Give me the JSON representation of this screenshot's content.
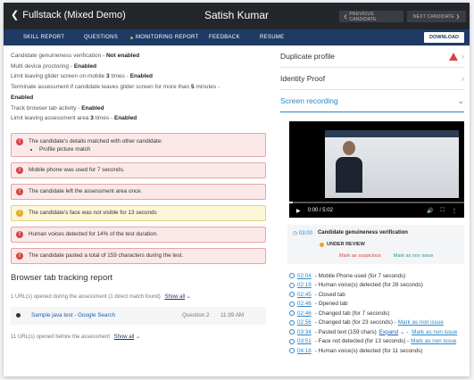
{
  "header": {
    "back_label": "Fullstack (Mixed Demo)",
    "candidate_name": "Satish Kumar",
    "prev_label": "PREVIOUS CANDIDATE",
    "next_label": "NEXT CANDIDATE"
  },
  "tabs": [
    {
      "label": "SKILL REPORT"
    },
    {
      "label": "QUESTIONS"
    },
    {
      "label": "MONITORING REPORT",
      "active": true
    },
    {
      "label": "FEEDBACK"
    },
    {
      "label": "RESUME"
    }
  ],
  "download_label": "DOWNLOAD",
  "settings": [
    {
      "text": "Candidate genuineness verification - ",
      "value": "Not enabled"
    },
    {
      "text": "Multi device proctoring - ",
      "value": "Enabled"
    },
    {
      "text_a": "Limit leaving glider screen on mobile ",
      "num": "3",
      "text_b": " times - ",
      "value": "Enabled"
    },
    {
      "text_a": "Terminate assessment if candidate leaves glider screen for more than ",
      "num": "5",
      "text_b": " minutes -"
    },
    {
      "value": "Enabled"
    },
    {
      "text": "Track browser tab activity - ",
      "value": "Enabled"
    },
    {
      "text_a": "Limit leaving assessment area ",
      "num": "3",
      "text_b": " times - ",
      "value": "Enabled"
    }
  ],
  "alerts": [
    {
      "text": "The candidate's details matched with other candidate:",
      "sub": "Profile picture match",
      "level": "error"
    },
    {
      "text": "Mobile phone was used for 7 seconds.",
      "level": "error"
    },
    {
      "text": "The candidate left the assessment area once.",
      "level": "error"
    },
    {
      "text": "The candidate's face was not visible for 13 seconds",
      "level": "warn"
    },
    {
      "text": "Human voices detected for 14% of the test duration.",
      "level": "error"
    },
    {
      "text": "The candidate pasted a total of 159 characters during the test.",
      "level": "error"
    }
  ],
  "browser_tab": {
    "title": "Browser tab tracking report",
    "during_note": "1 URL(s) opened during the assessment (1 direct match found)",
    "show_all": "Show all",
    "url_row": {
      "link": "Sample java test - Google Search",
      "question": "Question 2",
      "time": "11:39 AM"
    },
    "before_note": "11 URL(s) opened before the assessment"
  },
  "right": {
    "duplicate_label": "Duplicate profile",
    "identity_label": "Identity Proof",
    "recording_label": "Screen recording",
    "video_time": "0:00 / 5:02",
    "genuine": {
      "time": "03:00",
      "title": "Candidate genuineness verification",
      "status": "UNDER REVIEW",
      "mark_suspicious": "Mark as suspicious",
      "mark_non_issue": "Mark as non issue"
    },
    "events": [
      {
        "time": "02:04",
        "text": "- Mobile Phone used (for 7 seconds)"
      },
      {
        "time": "02:18",
        "text": "- Human voice(s) detected (for 28 seconds)"
      },
      {
        "time": "02:45",
        "text": "- Closed tab"
      },
      {
        "time": "02:46",
        "text": "- Opened tab"
      },
      {
        "time": "02:46",
        "text": "- Changed tab (for 7 seconds)"
      },
      {
        "time": "02:56",
        "text": "- Changed tab (for 23 seconds) -",
        "mark": "Mark as non issue"
      },
      {
        "time": "03:34",
        "text": "- Pasted text (159 chars)",
        "expand": "Expand",
        "mark": "Mark as non issue"
      },
      {
        "time": "03:51",
        "text": "- Face not detected (for 13 seconds) -",
        "mark": "Mark as non issue"
      },
      {
        "time": "04:18",
        "text": "- Human voice(s) detected (for 11 seconds)"
      }
    ]
  }
}
